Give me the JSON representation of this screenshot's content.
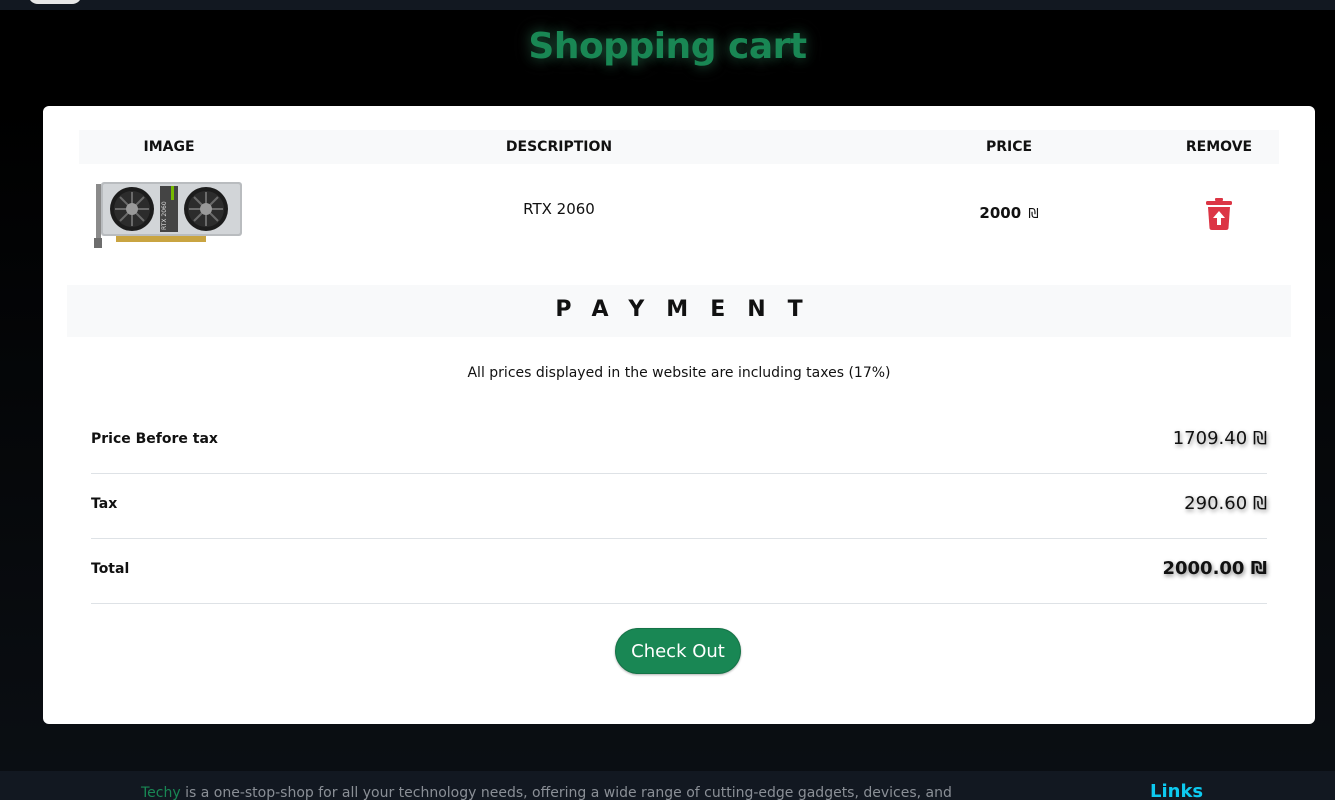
{
  "page": {
    "title": "Shopping cart"
  },
  "cart": {
    "headers": {
      "image": "IMAGE",
      "description": "DESCRIPTION",
      "price": "PRICE",
      "remove": "REMOVE"
    },
    "items": [
      {
        "description": "RTX 2060",
        "price": "2000",
        "currency": "₪",
        "image_icon": "gpu-card-image",
        "image_label": "RTX 2060",
        "remove_icon": "trash-icon"
      }
    ]
  },
  "payment": {
    "title": "PAYMENT",
    "tax_note": "All prices displayed in the website are including taxes (17%)",
    "rows": [
      {
        "label": "Price Before tax",
        "value": "1709.40 ₪"
      },
      {
        "label": "Tax",
        "value": "290.60 ₪"
      },
      {
        "label": "Total",
        "value": "2000.00 ₪"
      }
    ],
    "checkout_label": "Check Out"
  },
  "footer": {
    "brand": "Techy",
    "text": " is a one-stop-shop for all your technology needs, offering a wide range of cutting-edge gadgets, devices, and",
    "links_title": "Links"
  },
  "colors": {
    "accent": "#198754",
    "danger": "#dc3545",
    "links": "#0dcaf0"
  }
}
